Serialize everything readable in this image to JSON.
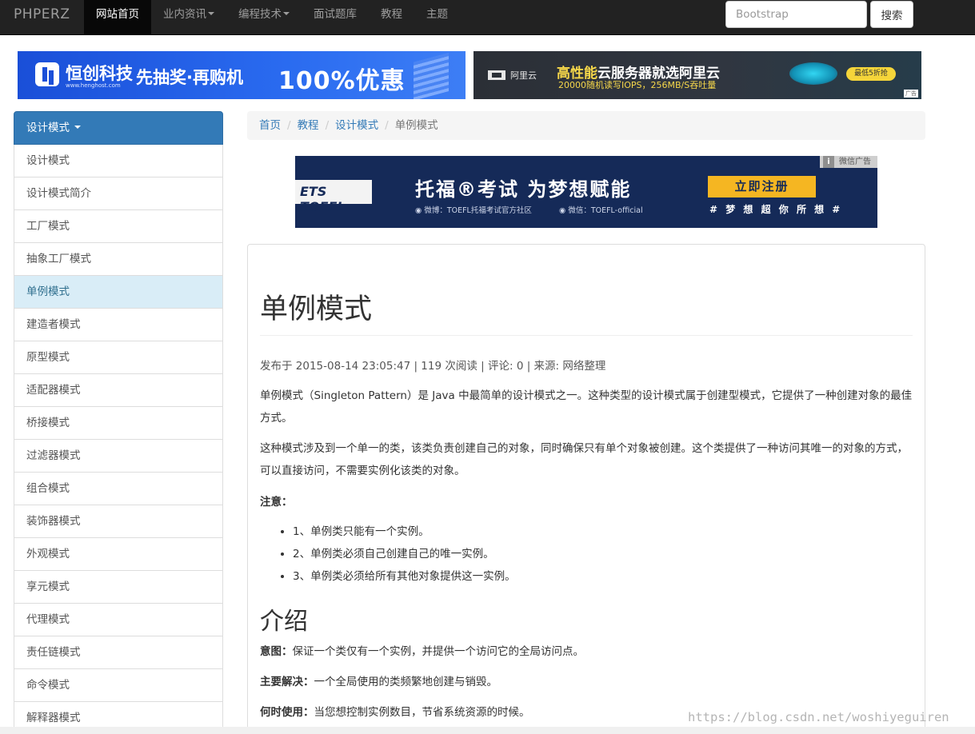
{
  "navbar": {
    "brand": "PHPERZ",
    "items": [
      {
        "label": "网站首页",
        "active": true,
        "dropdown": false
      },
      {
        "label": "业内资讯",
        "active": false,
        "dropdown": true
      },
      {
        "label": "编程技术",
        "active": false,
        "dropdown": true
      },
      {
        "label": "面试题库",
        "active": false,
        "dropdown": false
      },
      {
        "label": "教程",
        "active": false,
        "dropdown": false
      },
      {
        "label": "主题",
        "active": false,
        "dropdown": false
      }
    ],
    "search": {
      "placeholder": "Bootstrap",
      "value": "",
      "button_label": "搜索"
    }
  },
  "banners": {
    "left": {
      "brand": "恒创科技",
      "url": "www.henghost.com",
      "slogan": "先抽奖·再购机",
      "offer": "100%优惠"
    },
    "right": {
      "logo": "阿里云",
      "headline_prefix": "高性能",
      "headline_rest": "云服务器就选阿里云",
      "subline": "20000随机读写IOPS，256MB/S吞吐量",
      "cta": "最低5折抢",
      "ad_tag": "广告"
    }
  },
  "sidebar": {
    "header": "设计模式",
    "items": [
      {
        "label": "设计模式",
        "active": false
      },
      {
        "label": "设计模式简介",
        "active": false
      },
      {
        "label": "工厂模式",
        "active": false
      },
      {
        "label": "抽象工厂模式",
        "active": false
      },
      {
        "label": "单例模式",
        "active": true
      },
      {
        "label": "建造者模式",
        "active": false
      },
      {
        "label": "原型模式",
        "active": false
      },
      {
        "label": "适配器模式",
        "active": false
      },
      {
        "label": "桥接模式",
        "active": false
      },
      {
        "label": "过滤器模式",
        "active": false
      },
      {
        "label": "组合模式",
        "active": false
      },
      {
        "label": "装饰器模式",
        "active": false
      },
      {
        "label": "外观模式",
        "active": false
      },
      {
        "label": "享元模式",
        "active": false
      },
      {
        "label": "代理模式",
        "active": false
      },
      {
        "label": "责任链模式",
        "active": false
      },
      {
        "label": "命令模式",
        "active": false
      },
      {
        "label": "解释器模式",
        "active": false
      }
    ]
  },
  "breadcrumb": {
    "links": [
      "首页",
      "教程",
      "设计模式"
    ],
    "current": "单例模式",
    "separator": "/"
  },
  "toefl_ad": {
    "ad_tag": "微信广告",
    "info_icon": "i",
    "logo": "ETS TOEFL",
    "title": "托福®考试 为梦想赋能",
    "weibo": "微博：TOEFL托福考试官方社区",
    "wechat": "微信：TOEFL-official",
    "cta": "立即注册",
    "slogan": "# 梦 想 超 你 所 想 #"
  },
  "article": {
    "title": "单例模式",
    "meta": "发布于 2015-08-14 23:05:47 | 119 次阅读 | 评论: 0 | 来源: 网络整理",
    "paragraphs": [
      "单例模式（Singleton Pattern）是 Java 中最简单的设计模式之一。这种类型的设计模式属于创建型模式，它提供了一种创建对象的最佳方式。",
      "这种模式涉及到一个单一的类，该类负责创建自己的对象，同时确保只有单个对象被创建。这个类提供了一种访问其唯一的对象的方式，可以直接访问，不需要实例化该类的对象。"
    ],
    "note_label": "注意：",
    "notes": [
      "1、单例类只能有一个实例。",
      "2、单例类必须自己创建自己的唯一实例。",
      "3、单例类必须给所有其他对象提供这一实例。"
    ],
    "section_title": "介绍",
    "intro": [
      {
        "label": "意图：",
        "text": "保证一个类仅有一个实例，并提供一个访问它的全局访问点。"
      },
      {
        "label": "主要解决：",
        "text": "一个全局使用的类频繁地创建与销毁。"
      },
      {
        "label": "何时使用：",
        "text": "当您想控制实例数目，节省系统资源的时候。"
      }
    ]
  },
  "watermark": "https://blog.csdn.net/woshiyeguiren",
  "colors": {
    "navbar_bg": "#222222",
    "primary": "#337ab7",
    "active_item_bg": "#d9edf7",
    "link": "#337ab7"
  }
}
